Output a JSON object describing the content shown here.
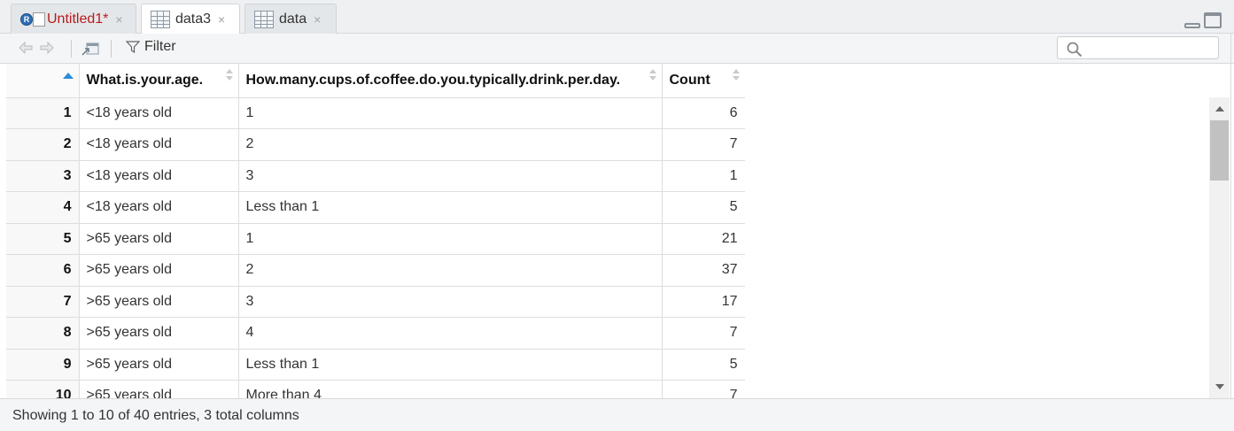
{
  "tabs": [
    {
      "label": "Untitled1*",
      "close": "×"
    },
    {
      "label": "data3",
      "close": "×"
    },
    {
      "label": "data",
      "close": "×"
    }
  ],
  "toolbar": {
    "filter_label": "Filter",
    "search_placeholder": ""
  },
  "table": {
    "columns": [
      "",
      "What.is.your.age.",
      "How.many.cups.of.coffee.do.you.typically.drink.per.day.",
      "Count"
    ],
    "rows": [
      {
        "n": "1",
        "age": "<18 years old",
        "cups": "1",
        "count": "6"
      },
      {
        "n": "2",
        "age": "<18 years old",
        "cups": "2",
        "count": "7"
      },
      {
        "n": "3",
        "age": "<18 years old",
        "cups": "3",
        "count": "1"
      },
      {
        "n": "4",
        "age": "<18 years old",
        "cups": "Less than 1",
        "count": "5"
      },
      {
        "n": "5",
        "age": ">65 years old",
        "cups": "1",
        "count": "21"
      },
      {
        "n": "6",
        "age": ">65 years old",
        "cups": "2",
        "count": "37"
      },
      {
        "n": "7",
        "age": ">65 years old",
        "cups": "3",
        "count": "17"
      },
      {
        "n": "8",
        "age": ">65 years old",
        "cups": "4",
        "count": "7"
      },
      {
        "n": "9",
        "age": ">65 years old",
        "cups": "Less than 1",
        "count": "5"
      },
      {
        "n": "10",
        "age": ">65 years old",
        "cups": "More than 4",
        "count": "7"
      }
    ]
  },
  "status": {
    "text": "Showing 1 to 10 of 40 entries, 3 total columns"
  },
  "colors": {
    "accent": "#2d8cd8",
    "unsaved_tab": "#b71c1c",
    "r_logo": "#2e6db3"
  },
  "icons": [
    "r-script-icon",
    "grid-icon",
    "close-icon",
    "back-arrow-icon",
    "forward-arrow-icon",
    "popout-icon",
    "filter-icon",
    "search-icon",
    "minimize-icon",
    "maximize-icon",
    "sort-icon"
  ]
}
